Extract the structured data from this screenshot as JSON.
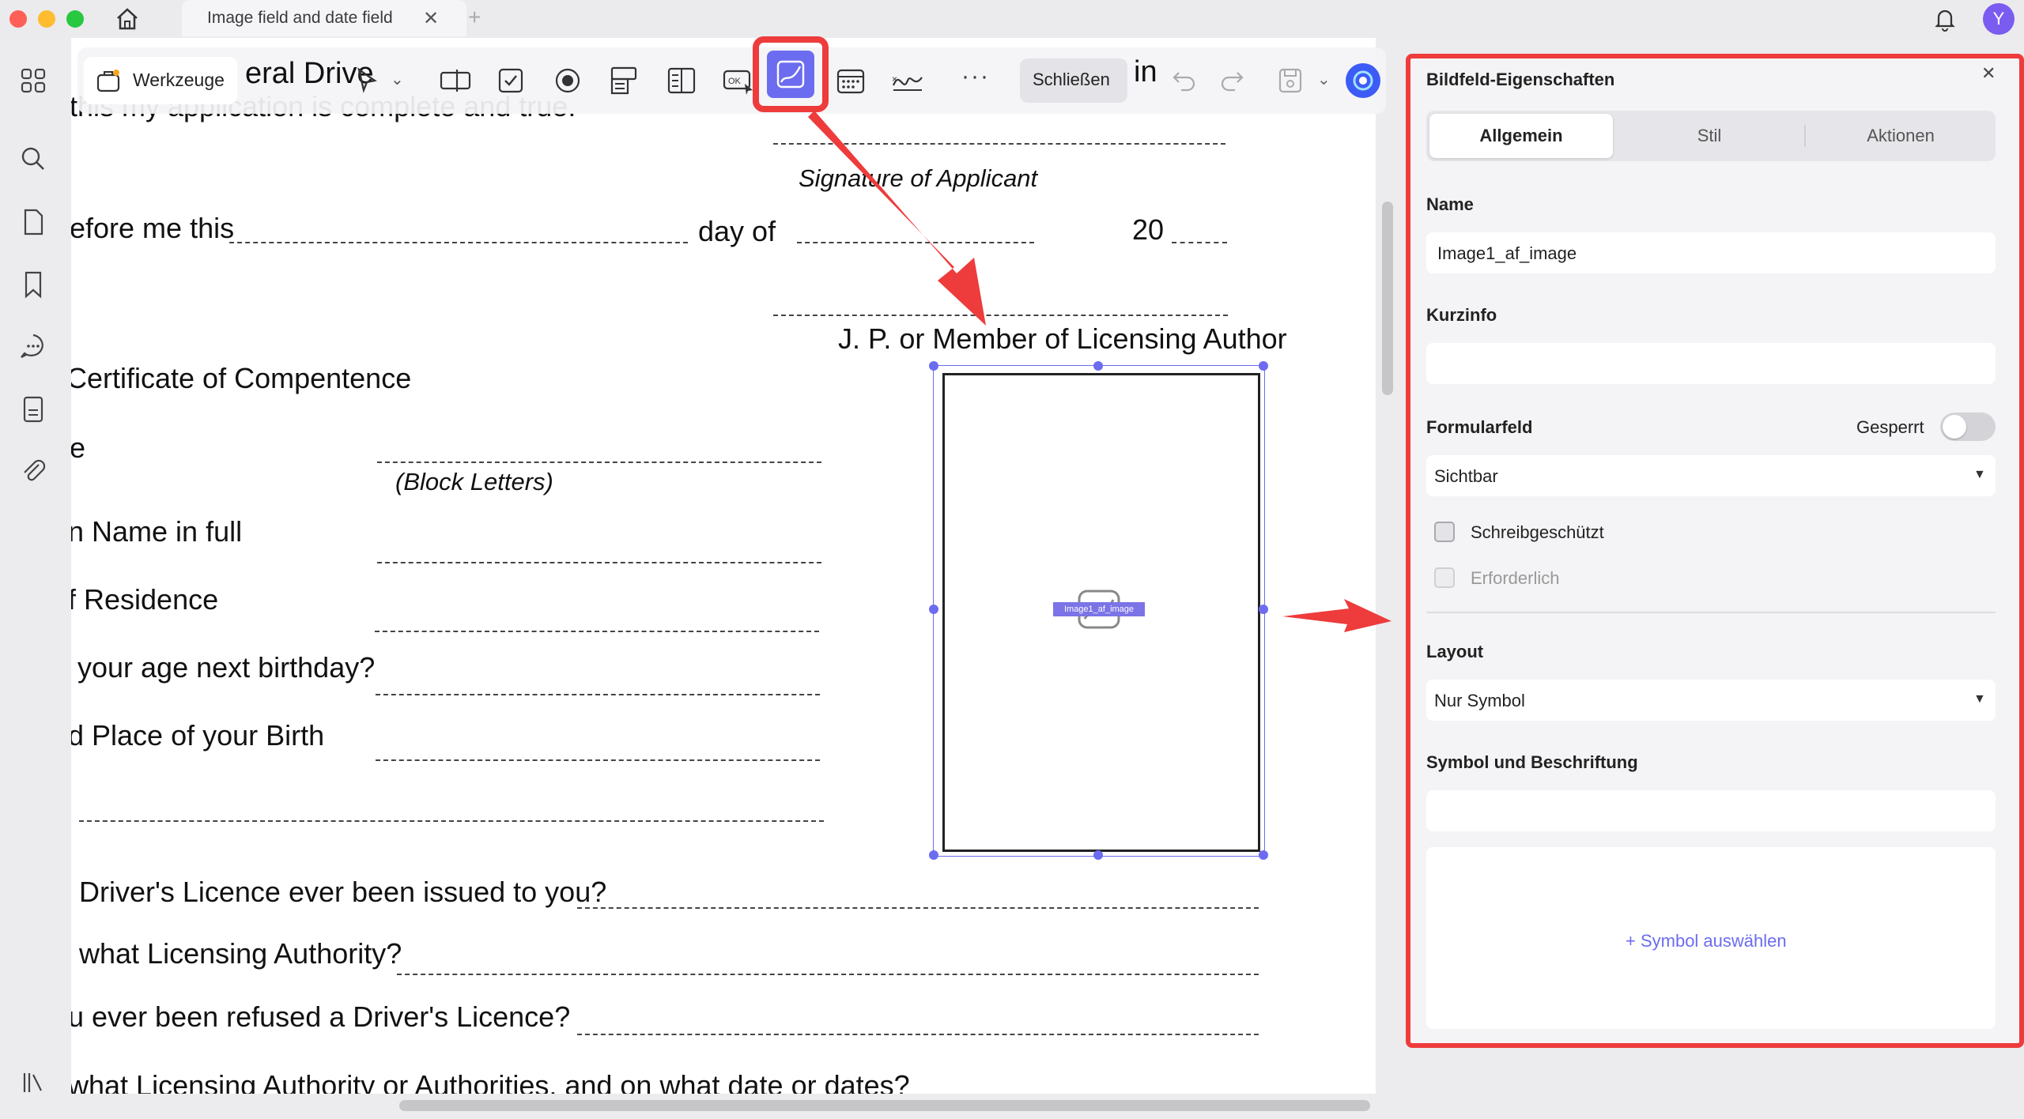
{
  "tab": {
    "title": "Image field and date field"
  },
  "user": {
    "avatar_initial": "Y"
  },
  "toolbar": {
    "tools_label": "Werkzeuge",
    "close_label": "Schließen"
  },
  "document": {
    "lines": {
      "top_line": "this my application is complete and true.",
      "title_fragment_left": "eral Drive",
      "title_fragment_right": "in",
      "signature": "Signature of Applicant",
      "before_me": "efore me this",
      "day_of": "day of",
      "year_prefix": "20",
      "jp": "J. P. or Member of Licensing Author",
      "certificate": "Certificate of Compentence",
      "e": "e",
      "block_letters": "(Block Letters)",
      "name_full": "n Name in full",
      "residence": "f Residence",
      "age": "your age next birthday?",
      "birth": "d Place of your Birth",
      "licence_issued": "Driver's Licence ever been issued to you?",
      "authority": "what Licensing Authority?",
      "refused": "u ever been refused a Driver's Licence?",
      "authorities": "what Licensing Authority or Authorities, and on what date or dates?"
    },
    "image_field_label": "Image1_af_image"
  },
  "panel": {
    "title": "Bildfeld-Eigenschaften",
    "tabs": [
      "Allgemein",
      "Stil",
      "Aktionen"
    ],
    "name_label": "Name",
    "name_value": "Image1_af_image",
    "tooltip_label": "Kurzinfo",
    "tooltip_value": "",
    "formfield_label": "Formularfeld",
    "locked_label": "Gesperrt",
    "locked": false,
    "visibility": "Sichtbar",
    "readonly_label": "Schreibgeschützt",
    "readonly": false,
    "required_label": "Erforderlich",
    "required": false,
    "layout_label": "Layout",
    "layout_value": "Nur Symbol",
    "symbol_label": "Symbol und Beschriftung",
    "select_symbol": "+ Symbol auswählen"
  },
  "colors": {
    "accent": "#6c6cf0",
    "highlight": "#ee3b3b",
    "panel_bg": "#f4f4f6"
  }
}
